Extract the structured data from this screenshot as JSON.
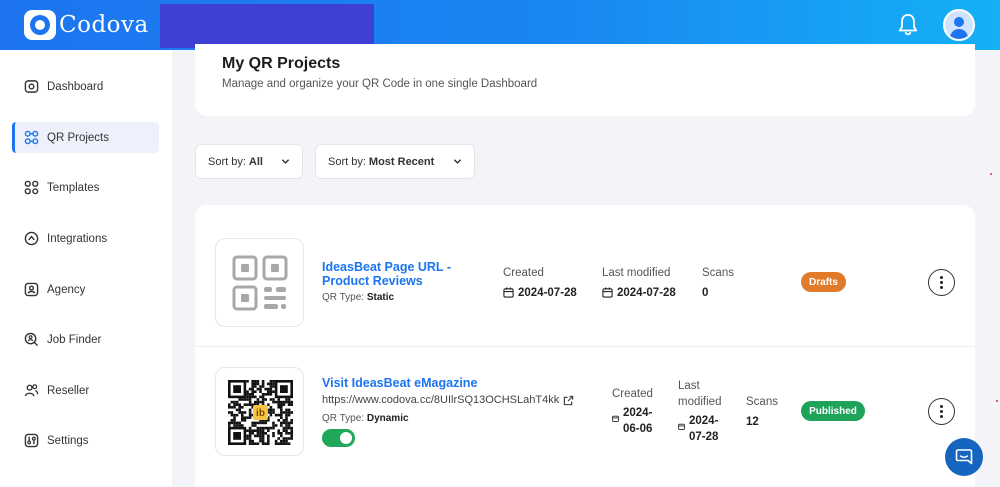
{
  "app": {
    "name": "Codova"
  },
  "colors": {
    "primary": "#1c74f0",
    "draft": "#e07b2c",
    "published": "#1fa35a"
  },
  "header": {
    "icons": [
      "bell-icon",
      "avatar-icon"
    ]
  },
  "sidebar": {
    "items": [
      {
        "label": "Dashboard",
        "icon": "dashboard-icon"
      },
      {
        "label": "QR Projects",
        "icon": "qr-icon",
        "active": true
      },
      {
        "label": "Templates",
        "icon": "templates-icon"
      },
      {
        "label": "Integrations",
        "icon": "integrations-icon"
      },
      {
        "label": "Agency",
        "icon": "agency-icon"
      },
      {
        "label": "Job Finder",
        "icon": "job-finder-icon"
      },
      {
        "label": "Reseller",
        "icon": "reseller-icon"
      },
      {
        "label": "Settings",
        "icon": "settings-icon"
      }
    ]
  },
  "page": {
    "title": "My QR Projects",
    "subtitle": "Manage and organize your QR Code in one single Dashboard"
  },
  "sort": {
    "type": {
      "prefix": "Sort by:",
      "value": "All"
    },
    "order": {
      "prefix": "Sort by:",
      "value": "Most Recent"
    }
  },
  "projects": [
    {
      "name": "IdeasBeat Page URL - Product Reviews",
      "qr_type_label": "QR Type:",
      "qr_type": "Static",
      "created_label": "Created",
      "created": "2024-07-28",
      "modified_label": "Last modified",
      "modified": "2024-07-28",
      "scans_label": "Scans",
      "scans": "0",
      "status": "Drafts"
    },
    {
      "name": "Visit IdeasBeat eMagazine",
      "url": "https://www.codova.cc/8UIlrSQ13OCHSLahT4kk",
      "qr_type_label": "QR Type:",
      "qr_type": "Dynamic",
      "created_label": "Created",
      "created": "2024-06-06",
      "modified_label": "Last modified",
      "modified": "2024-07-28",
      "scans_label": "Scans",
      "scans": "12",
      "status": "Published",
      "active": true,
      "qr_center_text": "ib"
    }
  ]
}
